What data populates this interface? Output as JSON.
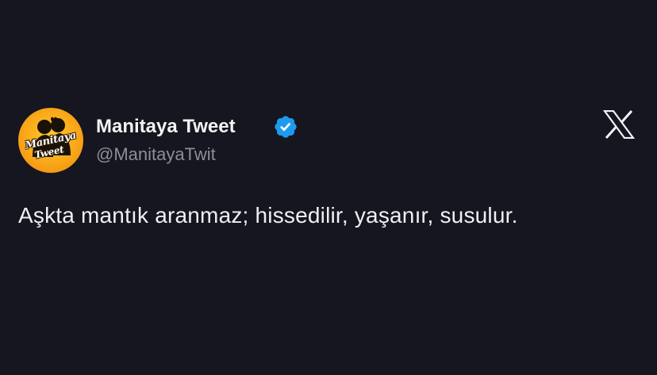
{
  "tweet": {
    "avatar": {
      "line1": "Manitaya",
      "line2": "Tweet",
      "background": "#f9a719"
    },
    "display_name": "Manitaya Tweet",
    "verified_badge_color": "#1d9bf0",
    "handle": "@ManitayaTwit",
    "text": "Aşkta mantık aranmaz; hissedilir, yaşanır, susulur.",
    "platform_icon": "x-logo-icon"
  },
  "colors": {
    "background": "#15161f",
    "text_primary": "#eef0f3",
    "text_secondary": "#8b8f96"
  }
}
